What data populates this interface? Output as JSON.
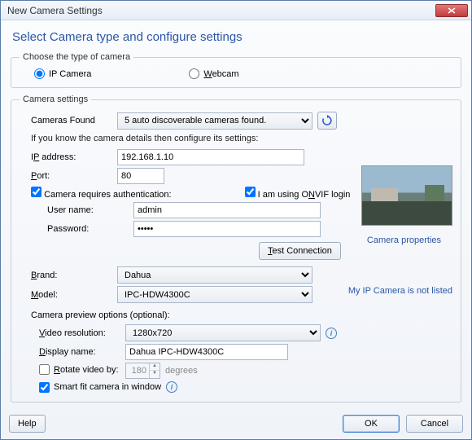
{
  "window": {
    "title": "New Camera Settings"
  },
  "heading": "Select Camera type and configure settings",
  "type_group": {
    "legend": "Choose the type of camera",
    "ip_label": "IP Camera",
    "webcam_label": "Webcam",
    "selected": "ip"
  },
  "settings_group": {
    "legend": "Camera settings",
    "cameras_found_label": "Cameras Found",
    "cameras_found_value": "5 auto discoverable cameras found.",
    "hint": "If you know the camera details then configure its settings:",
    "ip_label": "IP address:",
    "ip_prefix": "I",
    "ip_value": "192.168.1.10",
    "port_label": "ort:",
    "port_prefix": "P",
    "port_value": "80",
    "requires_auth_label": "Camera requires authentication:",
    "requires_auth_checked": true,
    "onvif_label_pre": "I am using O",
    "onvif_mid": "N",
    "onvif_post": "VIF login",
    "onvif_checked": true,
    "username_label": "User name:",
    "username_value": "admin",
    "password_label": "Password:",
    "password_value": "•••••",
    "camera_properties_link": "Camera properties",
    "test_btn": "Test Connection",
    "test_underline": "T",
    "brand_label": "rand:",
    "brand_prefix": "B",
    "brand_value": "Dahua",
    "model_label": "odel:",
    "model_prefix": "M",
    "model_value": "IPC-HDW4300C",
    "not_listed_link": "My IP Camera is not listed",
    "preview_section": "Camera preview options (optional):",
    "video_res_label": "ideo resolution:",
    "video_res_prefix": "V",
    "video_res_value": "1280x720",
    "display_name_label": "isplay name:",
    "display_name_prefix": "D",
    "display_name_value": "Dahua IPC-HDW4300C",
    "rotate_label": "otate video by:",
    "rotate_prefix": "R",
    "rotate_checked": false,
    "rotate_value": "180",
    "rotate_suffix": "degrees",
    "smartfit_label": "Smart fit camera in window",
    "smartfit_checked": true
  },
  "buttons": {
    "help": "Help",
    "ok": "OK",
    "cancel": "Cancel"
  },
  "icons": {
    "refresh": "refresh-icon",
    "info": "i"
  }
}
